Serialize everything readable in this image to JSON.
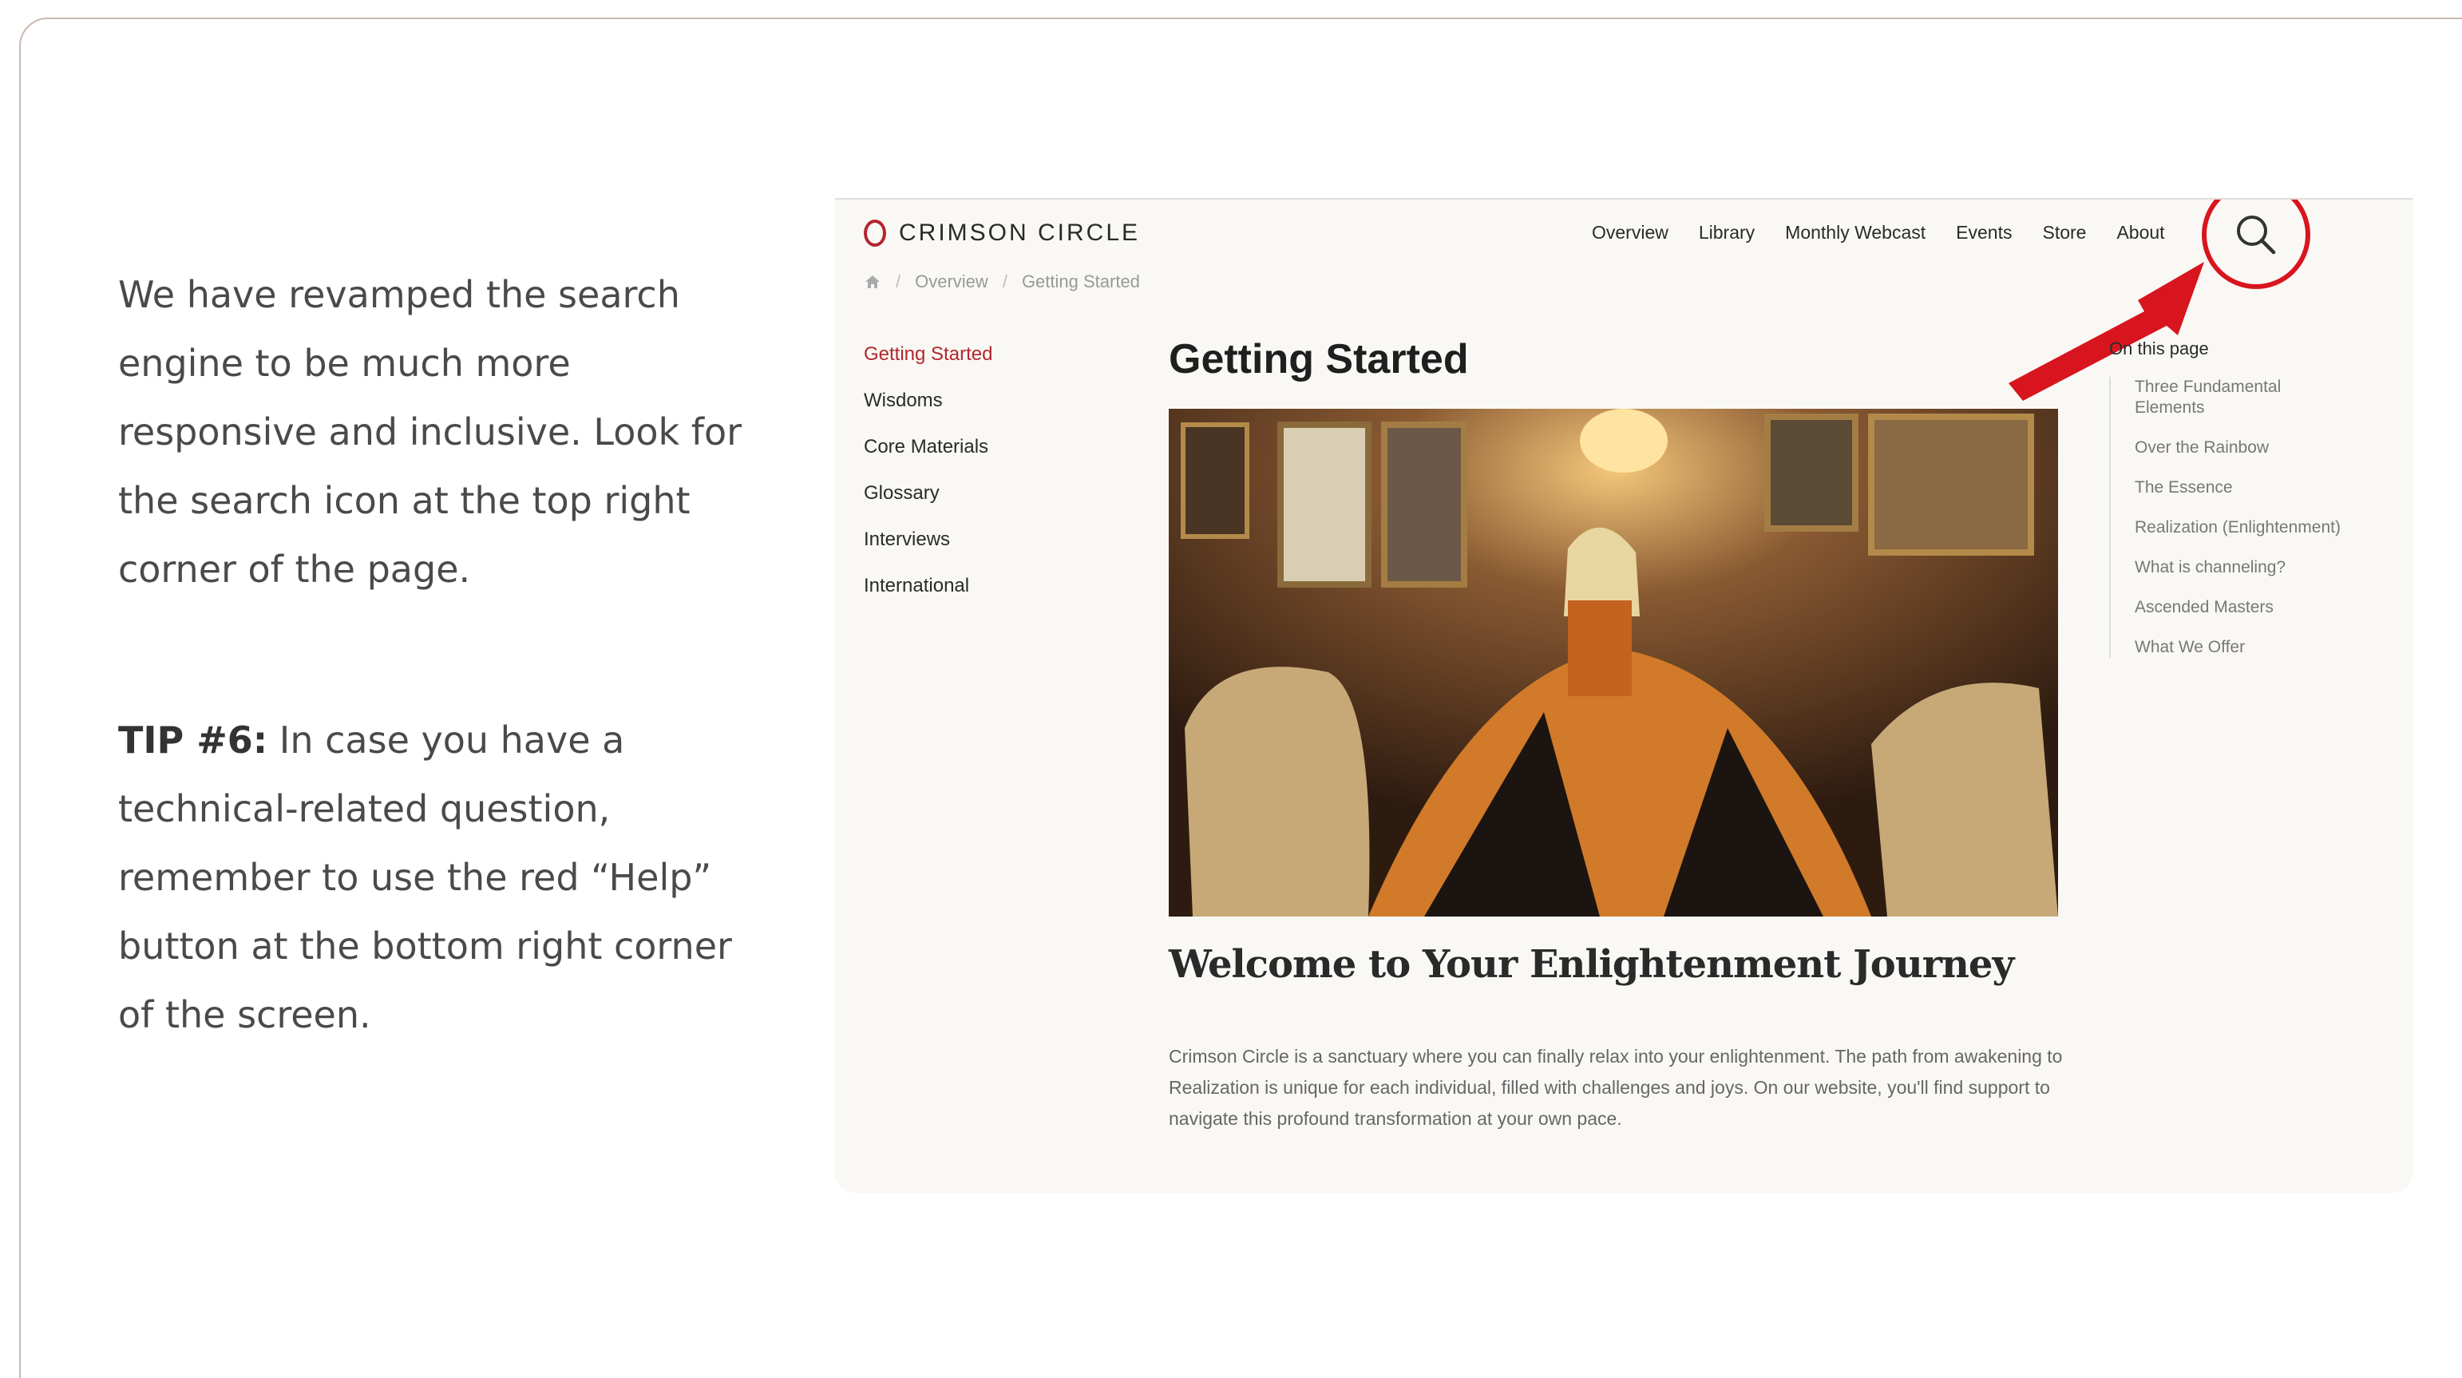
{
  "intro": {
    "paragraph": "We have revamped the search engine to be much more responsive and inclusive. Look for the search icon at the top right corner of the page.",
    "tip_label": "TIP #6:",
    "tip_text": " In case you have a technical-related question, remember to use the red “Help” button at the bottom right corner of the screen."
  },
  "site": {
    "logo": "CRIMSON CIRCLE",
    "nav": [
      "Overview",
      "Library",
      "Monthly Webcast",
      "Events",
      "Store",
      "About"
    ],
    "breadcrumb": [
      "Overview",
      "Getting Started"
    ],
    "sidenav": [
      "Getting Started",
      "Wisdoms",
      "Core Materials",
      "Glossary",
      "Interviews",
      "International"
    ],
    "page_title": "Getting Started",
    "welcome": "Welcome to Your Enlightenment Journey",
    "body": "Crimson Circle is a sanctuary where you can finally relax into your enlightenment. The path from awakening to Realization is unique for each individual, filled with challenges and joys. On our website, you'll find support to navigate this profound transformation at your own pace.",
    "toc_heading": "On this page",
    "toc": [
      "Three Fundamental Elements",
      "Over the Rainbow",
      "The Essence",
      "Realization (Enlightenment)",
      "What is channeling?",
      "Ascended Masters",
      "What We Offer"
    ]
  },
  "colors": {
    "accent": "#b3262e",
    "highlight": "#d8151f"
  },
  "icons": {
    "search": "search-icon",
    "home": "home-icon",
    "arrow": "arrow-icon"
  }
}
